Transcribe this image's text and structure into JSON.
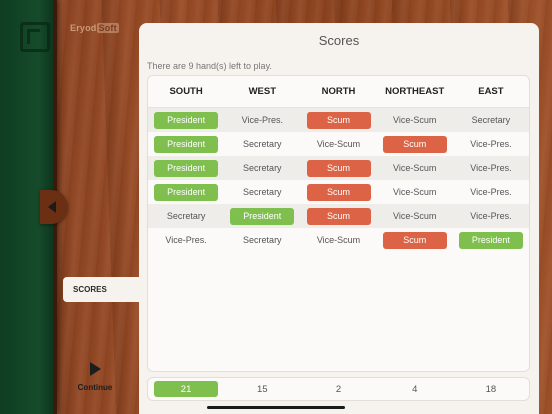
{
  "sidebar": {
    "brand_prefix": "Eryod",
    "brand_suffix": "Soft",
    "scores_tab": "SCORES",
    "continue_label": "Continue"
  },
  "panel": {
    "title": "Scores",
    "hands_left": "There are 9 hand(s) left to play."
  },
  "table": {
    "headers": [
      "SOUTH",
      "WEST",
      "NORTH",
      "NORTHEAST",
      "EAST"
    ],
    "rows": [
      [
        "President",
        "Vice-Pres.",
        "Scum",
        "Vice-Scum",
        "Secretary"
      ],
      [
        "President",
        "Secretary",
        "Vice-Scum",
        "Scum",
        "Vice-Pres."
      ],
      [
        "President",
        "Secretary",
        "Scum",
        "Vice-Scum",
        "Vice-Pres."
      ],
      [
        "President",
        "Secretary",
        "Scum",
        "Vice-Scum",
        "Vice-Pres."
      ],
      [
        "Secretary",
        "President",
        "Scum",
        "Vice-Scum",
        "Vice-Pres."
      ],
      [
        "Vice-Pres.",
        "Secretary",
        "Vice-Scum",
        "Scum",
        "President"
      ]
    ]
  },
  "totals": [
    "21",
    "15",
    "2",
    "4",
    "18"
  ],
  "colors": {
    "president": "#7fbf4d",
    "scum": "#dd6346",
    "felt": "#154b2b",
    "wood": "#8e4520"
  }
}
